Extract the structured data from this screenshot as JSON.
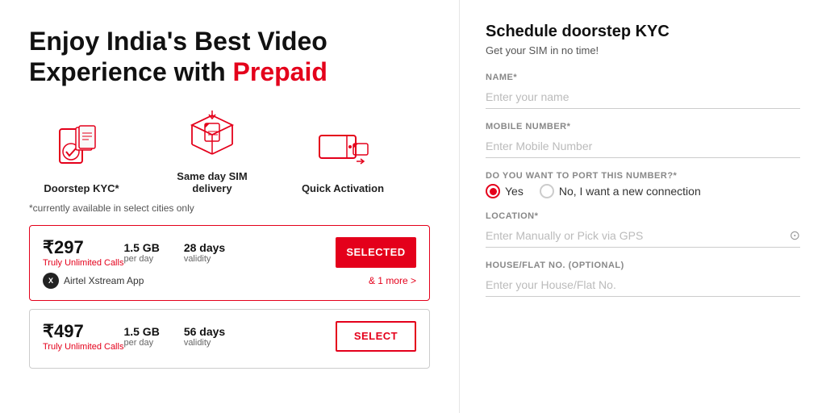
{
  "left": {
    "headline_part1": "Enjoy India's Best Video",
    "headline_part2": "Experience with ",
    "headline_highlight": "Prepaid",
    "features": [
      {
        "label": "Doorstep KYC*",
        "icon": "doorstep"
      },
      {
        "label": "Same day SIM delivery",
        "icon": "sim"
      },
      {
        "label": "Quick Activation",
        "icon": "activation"
      }
    ],
    "disclaimer": "*currently available in select cities only",
    "plans": [
      {
        "price": "₹297",
        "subtitle": "Truly Unlimited Calls",
        "data": "1.5 GB",
        "data_desc": "per day",
        "validity": "28 days",
        "validity_desc": "validity",
        "button_label": "SELECTED",
        "selected": true,
        "app_name": "Airtel Xstream App",
        "more_label": "& 1 more >"
      },
      {
        "price": "₹497",
        "subtitle": "Truly Unlimited Calls",
        "data": "1.5 GB",
        "data_desc": "per day",
        "validity": "56 days",
        "validity_desc": "validity",
        "button_label": "SELECT",
        "selected": false,
        "app_name": "",
        "more_label": ""
      }
    ]
  },
  "right": {
    "form_title": "Schedule doorstep KYC",
    "form_subtitle": "Get your SIM in no time!",
    "fields": {
      "name_label": "NAME*",
      "name_placeholder": "Enter your name",
      "mobile_label": "MOBILE NUMBER*",
      "mobile_placeholder": "Enter Mobile Number",
      "port_label": "DO YOU WANT TO PORT THIS NUMBER?*",
      "port_yes": "Yes",
      "port_no": "No, I want a new connection",
      "location_label": "LOCATION*",
      "location_placeholder": "Enter Manually or Pick via GPS",
      "house_label": "HOUSE/FLAT NO. (OPTIONAL)",
      "house_placeholder": "Enter your House/Flat No."
    }
  }
}
